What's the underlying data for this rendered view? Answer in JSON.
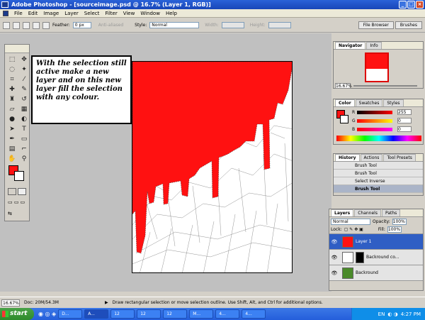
{
  "window": {
    "title": "Adobe Photoshop - [sourceimage.psd @ 16.7% (Layer 1, RGB)]"
  },
  "menu": [
    "File",
    "Edit",
    "Image",
    "Layer",
    "Select",
    "Filter",
    "View",
    "Window",
    "Help"
  ],
  "options": {
    "feather_label": "Feather:",
    "feather_value": "0 px",
    "antialiased": "Anti-aliased",
    "style_label": "Style:",
    "style_value": "Normal",
    "width_label": "Width:",
    "height_label": "Height:"
  },
  "right_tabs": [
    "File Browser",
    "Brushes"
  ],
  "callout": "With the selection still active make a new layer and on this new layer fill the selection with any colour.",
  "navigator": {
    "tabs": [
      "Navigator",
      "Info"
    ],
    "zoom": "16.67%"
  },
  "color_panel": {
    "tabs": [
      "Color",
      "Swatches",
      "Styles"
    ],
    "r": "255",
    "g": "0",
    "b": "0",
    "r_label": "R",
    "g_label": "G",
    "b_label": "B"
  },
  "history": {
    "tabs": [
      "History",
      "Actions",
      "Tool Presets"
    ],
    "items": [
      "Brush Tool",
      "Brush Tool",
      "Select Inverse",
      "Brush Tool"
    ]
  },
  "layers": {
    "tabs": [
      "Layers",
      "Channels",
      "Paths"
    ],
    "mode": "Normal",
    "opacity_label": "Opacity:",
    "opacity": "100%",
    "lock_label": "Lock:",
    "fill_label": "Fill:",
    "fill": "100%",
    "items": [
      "Layer 1",
      "Backround co...",
      "Backround"
    ]
  },
  "status": {
    "zoom": "16.67%",
    "doc": "Doc: 20M/54.3M",
    "hint": "Draw rectangular selection or move selection outline.  Use Shift, Alt, and Ctrl for additional options."
  },
  "taskbar": {
    "start": "start",
    "buttons": [
      "D...",
      "A...",
      "12",
      "12",
      "12",
      "M...",
      "4...",
      "4..."
    ],
    "lang": "EN",
    "time": "4:27 PM"
  },
  "colors": {
    "fill_red": "#ff1111",
    "xp_blue": "#245edb"
  }
}
